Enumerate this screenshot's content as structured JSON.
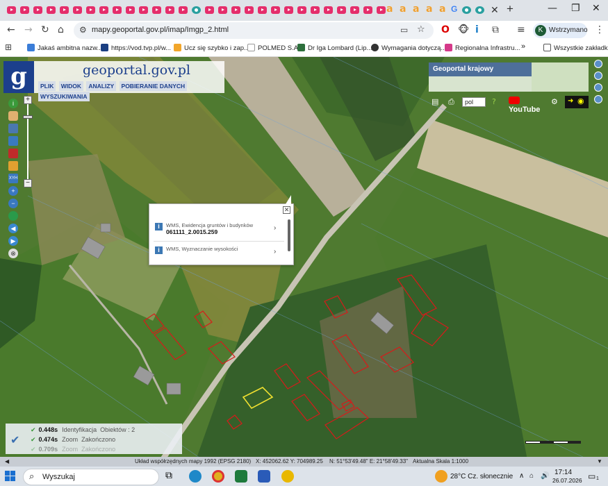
{
  "browser": {
    "tab_letter": "a",
    "tab_google_letter": "G",
    "url": "mapy.geoportal.gov.pl/imap/Imgp_2.html",
    "profile_initial": "K",
    "profile_label": "Wstrzymano",
    "bookmarks": [
      "Jakaś ambitna nazw...",
      "https://vod.tvp.pl/w...",
      "Ucz się szybko i zap...",
      "POLMED S.A.",
      "Dr Iga Lombard (Lip...",
      "Wymagania dotyczą...",
      "Regionalna Infrastru..."
    ],
    "bookmarks_more": "»",
    "all_bookmarks": "Wszystkie zakładki"
  },
  "geoportal": {
    "logo_letter": "g",
    "site_name": "geoportal.gov.pl",
    "menu": [
      "PLIK",
      "WIDOK",
      "ANALIZY",
      "POBIERANIE DANYCH",
      "WYSZUKIWANIA"
    ],
    "krajowy_title": "Geoportal krajowy",
    "language": "pol",
    "youtube_label": "YouTube"
  },
  "popup": {
    "rows": [
      {
        "layer": "WMS, Ewidencja gruntów i budynków",
        "value": "061111_2.0015.259"
      },
      {
        "layer": "WMS, Wyznaczanie wysokości",
        "value": ""
      }
    ]
  },
  "status_log": [
    {
      "time": "0.448s",
      "action": "Identyfikacja",
      "detail": "Obiektów : 2"
    },
    {
      "time": "0.474s",
      "action": "Zoom",
      "detail": "Zakończono"
    },
    {
      "time": "0.709s",
      "action": "Zoom",
      "detail": "Zakończono"
    }
  ],
  "map_status": {
    "crs": "Układ współrzędnych mapy 1992 (EPSG 2180)",
    "xy": "X: 452062.62 Y: 704989.25",
    "latlon": "N: 51°53'49.48\" E: 21°58'49.33\"",
    "scale": "Aktualna Skala 1:1000"
  },
  "taskbar": {
    "search_label": "Wyszukaj",
    "weather": "28°C  Cz. słonecznie",
    "time": "17:14",
    "date": "26.07.2026",
    "notification_count": "1"
  },
  "colors": {
    "parcel_outline": "#d81a1a",
    "highlight_parcel": "#f0e030",
    "geoportal_blue": "#1c3f8c"
  }
}
